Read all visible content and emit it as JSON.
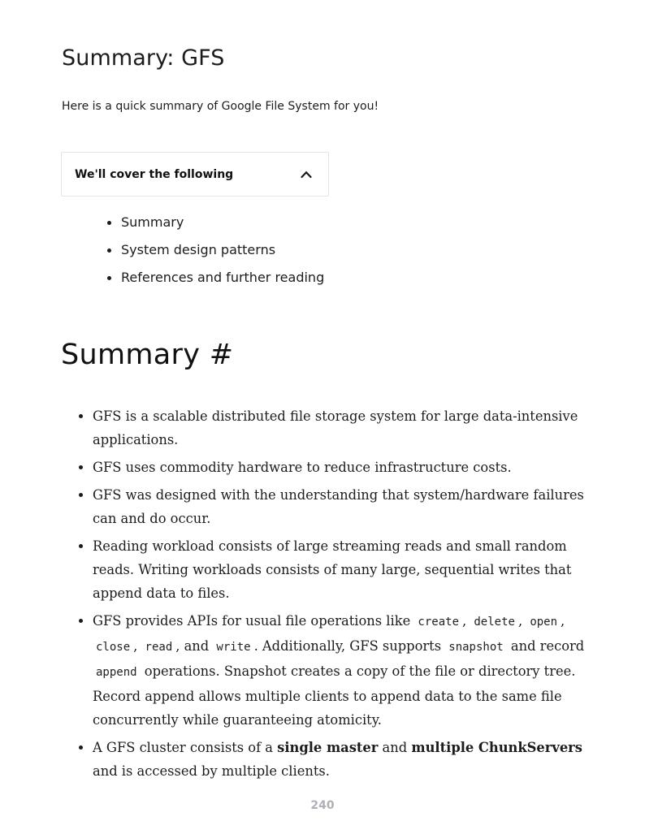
{
  "header": {
    "title": "Summary: GFS",
    "intro": "Here is a quick summary of Google File System for you!"
  },
  "toc": {
    "label": "We'll cover the following",
    "toggle_icon": "chevron-up-icon",
    "items": [
      "Summary",
      "System design patterns",
      "References and further reading"
    ]
  },
  "section": {
    "heading": "Summary",
    "anchor": "#"
  },
  "bullets": {
    "b1": "GFS is a scalable distributed file storage system for large data-intensive applications.",
    "b2": "GFS uses commodity hardware to reduce infrastructure costs.",
    "b3": "GFS was designed with the understanding that system/hardware failures can and do occur.",
    "b4": "Reading workload consists of large streaming reads and small random reads. Writing workloads consists of many large, sequential writes that append data to files.",
    "b5": {
      "t1": "GFS provides APIs for usual file operations like",
      "c1": "create",
      "s1": ",",
      "c2": "delete",
      "s2": ",",
      "c3": "open",
      "s3": ",",
      "c4": "close",
      "s4": ",",
      "c5": "read",
      "s5": ", and",
      "c6": "write",
      "t2": ". Additionally, GFS supports",
      "c7": "snapshot",
      "t3": "and record",
      "c8": "append",
      "t4": "operations. Snapshot creates a copy of the file or directory tree. Record append allows multiple clients to append data to the same file concurrently while guaranteeing atomicity."
    },
    "b6": {
      "t1": "A GFS cluster consists of a",
      "bold1": "single master",
      "t2": "and",
      "bold2": "multiple ChunkServers",
      "t3": "and is accessed by multiple clients."
    }
  },
  "footer": {
    "page_number": "240"
  }
}
